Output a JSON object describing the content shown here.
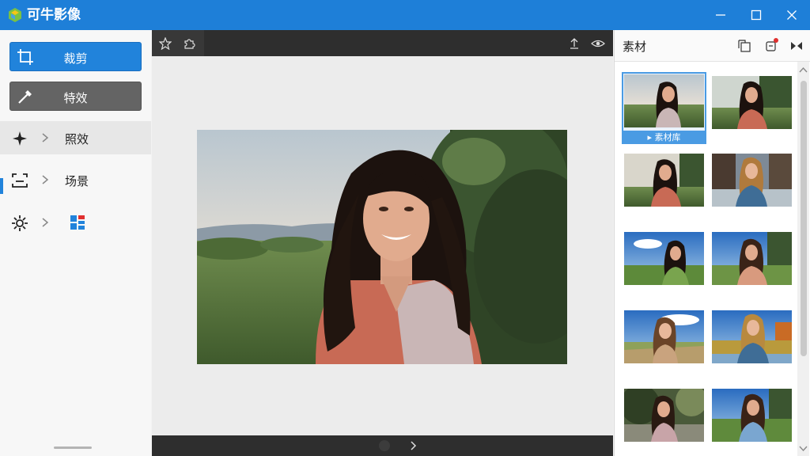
{
  "app": {
    "title": "可牛影像"
  },
  "window_controls": [
    "minimize",
    "maximize",
    "close"
  ],
  "sidebar": {
    "crop_button": {
      "label": "裁剪",
      "icon": "crop-icon"
    },
    "effects_button": {
      "label": "特效",
      "icon": "magic-wand-icon"
    },
    "items": [
      {
        "label": "照效",
        "icon": "sparkle-icon"
      },
      {
        "label": "场景",
        "icon": "scene-frame-icon"
      },
      {
        "label": "",
        "icon": "gear-icon",
        "extra_icon": "layout-grid-icon"
      }
    ]
  },
  "canvas": {
    "toolbar_left": [
      "star-icon",
      "puzzle-icon"
    ],
    "toolbar_right": [
      "upload-icon",
      "eye-icon"
    ],
    "photo_subject": "portrait"
  },
  "right_panel": {
    "title": "素材",
    "header_icons": [
      "export-icon",
      "notification-icon",
      "compare-icon"
    ],
    "selected_thumb_label": "素材库",
    "thumbnail_count": 10
  },
  "colors": {
    "titlebar": "#1e7fd8",
    "accent": "#2183db",
    "effects_button": "#646464",
    "canvas_bar": "#2e2e2e"
  }
}
